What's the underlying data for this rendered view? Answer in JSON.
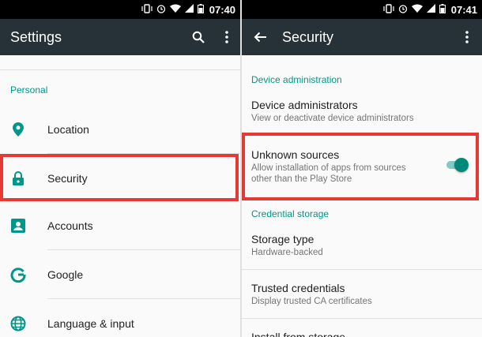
{
  "colors": {
    "accent": "#009688",
    "toolbar": "#263238",
    "highlight": "#e53935"
  },
  "left": {
    "status": {
      "time": "07:40"
    },
    "title": "Settings",
    "section": "Personal",
    "items": [
      {
        "label": "Location",
        "icon": "location-pin-icon"
      },
      {
        "label": "Security",
        "icon": "lock-icon"
      },
      {
        "label": "Accounts",
        "icon": "account-box-icon"
      },
      {
        "label": "Google",
        "icon": "google-icon"
      },
      {
        "label": "Language & input",
        "icon": "globe-icon"
      }
    ]
  },
  "right": {
    "status": {
      "time": "07:41"
    },
    "title": "Security",
    "sections": [
      "Device administration",
      "Credential storage"
    ],
    "items": [
      {
        "label": "Device administrators",
        "sub": "View or deactivate device administrators"
      },
      {
        "label": "Unknown sources",
        "sub1": "Allow installation of apps from sources",
        "sub2": "other than the Play Store",
        "toggle_on": true
      },
      {
        "label": "Storage type",
        "sub": "Hardware-backed"
      },
      {
        "label": "Trusted credentials",
        "sub": "Display trusted CA certificates"
      },
      {
        "label": "Install from storage"
      }
    ]
  }
}
